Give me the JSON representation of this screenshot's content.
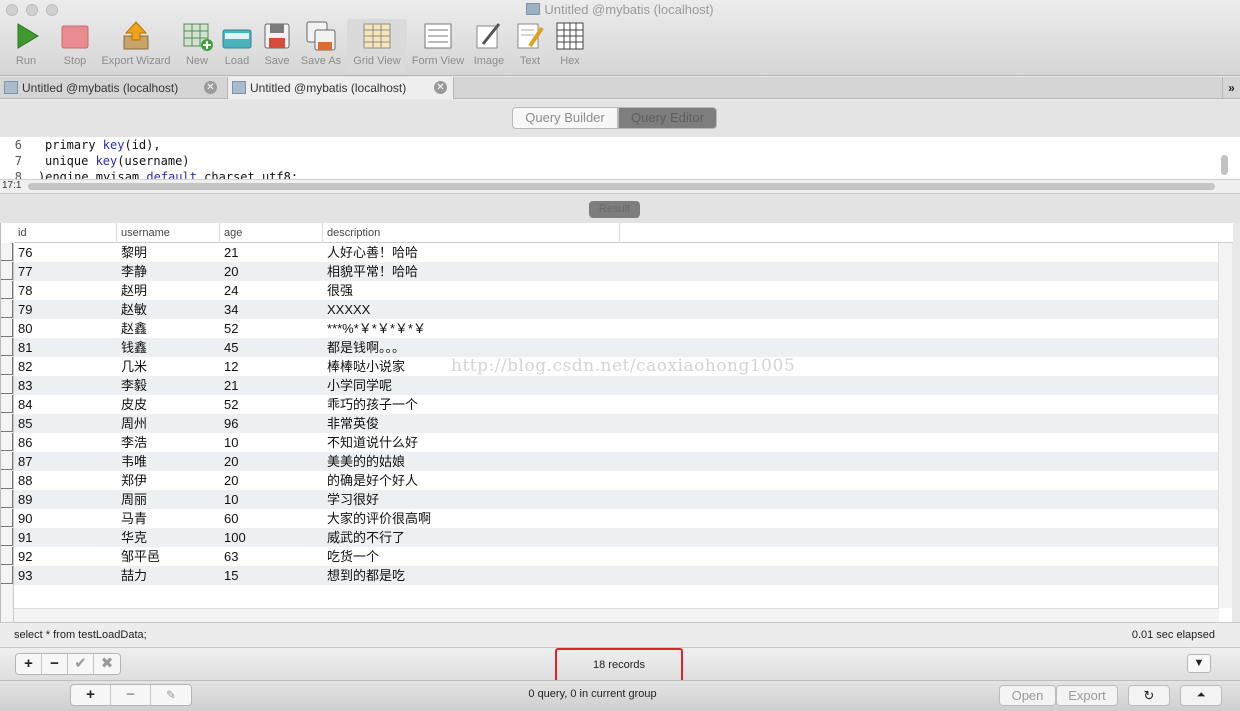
{
  "window": {
    "title": "Untitled @mybatis (localhost)"
  },
  "toolbar": {
    "run": "Run",
    "stop": "Stop",
    "export_wizard": "Export Wizard",
    "new": "New",
    "load": "Load",
    "save": "Save",
    "save_as": "Save As",
    "grid_view": "Grid View",
    "form_view": "Form View",
    "image": "Image",
    "text": "Text",
    "hex": "Hex"
  },
  "tabs": [
    {
      "label": "Untitled @mybatis (localhost)"
    },
    {
      "label": "Untitled @mybatis (localhost)"
    }
  ],
  "mode": {
    "query_builder": "Query Builder",
    "query_editor": "Query Editor"
  },
  "editor": {
    "lines": [
      {
        "num": "6",
        "pre": "primary ",
        "kw": "key",
        "post": "(id),"
      },
      {
        "num": "7",
        "pre": "unique ",
        "kw": "key",
        "post": "(username)"
      },
      {
        "num": "8",
        "pre": ")engine myisam ",
        "kw": "default",
        "post": " charset utf8;"
      }
    ],
    "cursor_position": "17:1"
  },
  "result": {
    "label": "Result"
  },
  "grid": {
    "columns": [
      "id",
      "username",
      "age",
      "description"
    ],
    "rows": [
      [
        "76",
        "黎明",
        "21",
        "人好心善！哈哈"
      ],
      [
        "77",
        "李静",
        "20",
        "相貌平常！哈哈"
      ],
      [
        "78",
        "赵明",
        "24",
        "很强"
      ],
      [
        "79",
        "赵敏",
        "34",
        "XXXXX"
      ],
      [
        "80",
        "赵鑫",
        "52",
        "***%*￥*￥*￥*￥"
      ],
      [
        "81",
        "钱鑫",
        "45",
        "都是钱啊。。。"
      ],
      [
        "82",
        "几米",
        "12",
        "棒棒哒小说家"
      ],
      [
        "83",
        "李毅",
        "21",
        "小学同学呢"
      ],
      [
        "84",
        "皮皮",
        "52",
        "乖巧的孩子一个"
      ],
      [
        "85",
        "周州",
        "96",
        "非常英俊"
      ],
      [
        "86",
        "李浩",
        "10",
        "不知道说什么好"
      ],
      [
        "87",
        "韦唯",
        "20",
        "美美的的姑娘"
      ],
      [
        "88",
        "郑伊",
        "20",
        "的确是好个好人"
      ],
      [
        "89",
        "周丽",
        "10",
        "学习很好"
      ],
      [
        "90",
        "马青",
        "60",
        "大家的评价很高啊"
      ],
      [
        "91",
        "华克",
        "100",
        "威武的不行了"
      ],
      [
        "92",
        "邹平邑",
        "63",
        "吃货一个"
      ],
      [
        "93",
        "喆力",
        "15",
        "想到的都是吃"
      ]
    ]
  },
  "watermark": "http://blog.csdn.net/caoxiaohong1005",
  "status": {
    "sql": "select * from testLoadData;",
    "elapsed": "0.01 sec elapsed",
    "records": "18 records"
  },
  "footer": {
    "summary": "0 query, 0 in current group",
    "open": "Open",
    "export": "Export"
  },
  "colors": {
    "highlight_border": "#d9262b",
    "alt_row": "#ecf0f2"
  }
}
